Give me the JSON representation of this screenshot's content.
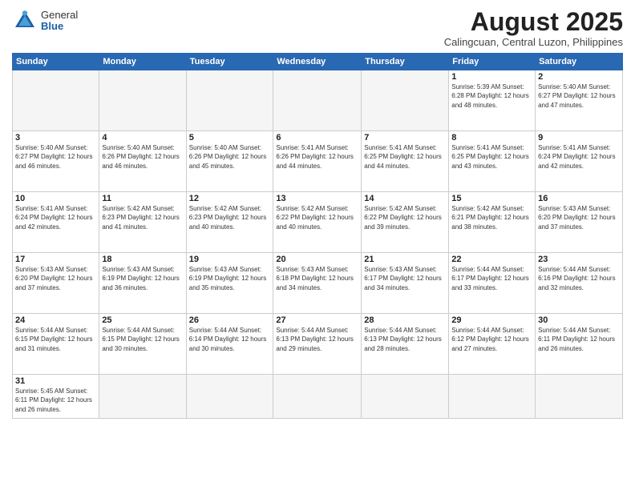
{
  "header": {
    "logo_general": "General",
    "logo_blue": "Blue",
    "month_year": "August 2025",
    "location": "Calingcuan, Central Luzon, Philippines"
  },
  "weekdays": [
    "Sunday",
    "Monday",
    "Tuesday",
    "Wednesday",
    "Thursday",
    "Friday",
    "Saturday"
  ],
  "weeks": [
    [
      {
        "day": "",
        "info": ""
      },
      {
        "day": "",
        "info": ""
      },
      {
        "day": "",
        "info": ""
      },
      {
        "day": "",
        "info": ""
      },
      {
        "day": "",
        "info": ""
      },
      {
        "day": "1",
        "info": "Sunrise: 5:39 AM\nSunset: 6:28 PM\nDaylight: 12 hours\nand 48 minutes."
      },
      {
        "day": "2",
        "info": "Sunrise: 5:40 AM\nSunset: 6:27 PM\nDaylight: 12 hours\nand 47 minutes."
      }
    ],
    [
      {
        "day": "3",
        "info": "Sunrise: 5:40 AM\nSunset: 6:27 PM\nDaylight: 12 hours\nand 46 minutes."
      },
      {
        "day": "4",
        "info": "Sunrise: 5:40 AM\nSunset: 6:26 PM\nDaylight: 12 hours\nand 46 minutes."
      },
      {
        "day": "5",
        "info": "Sunrise: 5:40 AM\nSunset: 6:26 PM\nDaylight: 12 hours\nand 45 minutes."
      },
      {
        "day": "6",
        "info": "Sunrise: 5:41 AM\nSunset: 6:26 PM\nDaylight: 12 hours\nand 44 minutes."
      },
      {
        "day": "7",
        "info": "Sunrise: 5:41 AM\nSunset: 6:25 PM\nDaylight: 12 hours\nand 44 minutes."
      },
      {
        "day": "8",
        "info": "Sunrise: 5:41 AM\nSunset: 6:25 PM\nDaylight: 12 hours\nand 43 minutes."
      },
      {
        "day": "9",
        "info": "Sunrise: 5:41 AM\nSunset: 6:24 PM\nDaylight: 12 hours\nand 42 minutes."
      }
    ],
    [
      {
        "day": "10",
        "info": "Sunrise: 5:41 AM\nSunset: 6:24 PM\nDaylight: 12 hours\nand 42 minutes."
      },
      {
        "day": "11",
        "info": "Sunrise: 5:42 AM\nSunset: 6:23 PM\nDaylight: 12 hours\nand 41 minutes."
      },
      {
        "day": "12",
        "info": "Sunrise: 5:42 AM\nSunset: 6:23 PM\nDaylight: 12 hours\nand 40 minutes."
      },
      {
        "day": "13",
        "info": "Sunrise: 5:42 AM\nSunset: 6:22 PM\nDaylight: 12 hours\nand 40 minutes."
      },
      {
        "day": "14",
        "info": "Sunrise: 5:42 AM\nSunset: 6:22 PM\nDaylight: 12 hours\nand 39 minutes."
      },
      {
        "day": "15",
        "info": "Sunrise: 5:42 AM\nSunset: 6:21 PM\nDaylight: 12 hours\nand 38 minutes."
      },
      {
        "day": "16",
        "info": "Sunrise: 5:43 AM\nSunset: 6:20 PM\nDaylight: 12 hours\nand 37 minutes."
      }
    ],
    [
      {
        "day": "17",
        "info": "Sunrise: 5:43 AM\nSunset: 6:20 PM\nDaylight: 12 hours\nand 37 minutes."
      },
      {
        "day": "18",
        "info": "Sunrise: 5:43 AM\nSunset: 6:19 PM\nDaylight: 12 hours\nand 36 minutes."
      },
      {
        "day": "19",
        "info": "Sunrise: 5:43 AM\nSunset: 6:19 PM\nDaylight: 12 hours\nand 35 minutes."
      },
      {
        "day": "20",
        "info": "Sunrise: 5:43 AM\nSunset: 6:18 PM\nDaylight: 12 hours\nand 34 minutes."
      },
      {
        "day": "21",
        "info": "Sunrise: 5:43 AM\nSunset: 6:17 PM\nDaylight: 12 hours\nand 34 minutes."
      },
      {
        "day": "22",
        "info": "Sunrise: 5:44 AM\nSunset: 6:17 PM\nDaylight: 12 hours\nand 33 minutes."
      },
      {
        "day": "23",
        "info": "Sunrise: 5:44 AM\nSunset: 6:16 PM\nDaylight: 12 hours\nand 32 minutes."
      }
    ],
    [
      {
        "day": "24",
        "info": "Sunrise: 5:44 AM\nSunset: 6:15 PM\nDaylight: 12 hours\nand 31 minutes."
      },
      {
        "day": "25",
        "info": "Sunrise: 5:44 AM\nSunset: 6:15 PM\nDaylight: 12 hours\nand 30 minutes."
      },
      {
        "day": "26",
        "info": "Sunrise: 5:44 AM\nSunset: 6:14 PM\nDaylight: 12 hours\nand 30 minutes."
      },
      {
        "day": "27",
        "info": "Sunrise: 5:44 AM\nSunset: 6:13 PM\nDaylight: 12 hours\nand 29 minutes."
      },
      {
        "day": "28",
        "info": "Sunrise: 5:44 AM\nSunset: 6:13 PM\nDaylight: 12 hours\nand 28 minutes."
      },
      {
        "day": "29",
        "info": "Sunrise: 5:44 AM\nSunset: 6:12 PM\nDaylight: 12 hours\nand 27 minutes."
      },
      {
        "day": "30",
        "info": "Sunrise: 5:44 AM\nSunset: 6:11 PM\nDaylight: 12 hours\nand 26 minutes."
      }
    ],
    [
      {
        "day": "31",
        "info": "Sunrise: 5:45 AM\nSunset: 6:11 PM\nDaylight: 12 hours\nand 26 minutes."
      },
      {
        "day": "",
        "info": ""
      },
      {
        "day": "",
        "info": ""
      },
      {
        "day": "",
        "info": ""
      },
      {
        "day": "",
        "info": ""
      },
      {
        "day": "",
        "info": ""
      },
      {
        "day": "",
        "info": ""
      }
    ]
  ]
}
